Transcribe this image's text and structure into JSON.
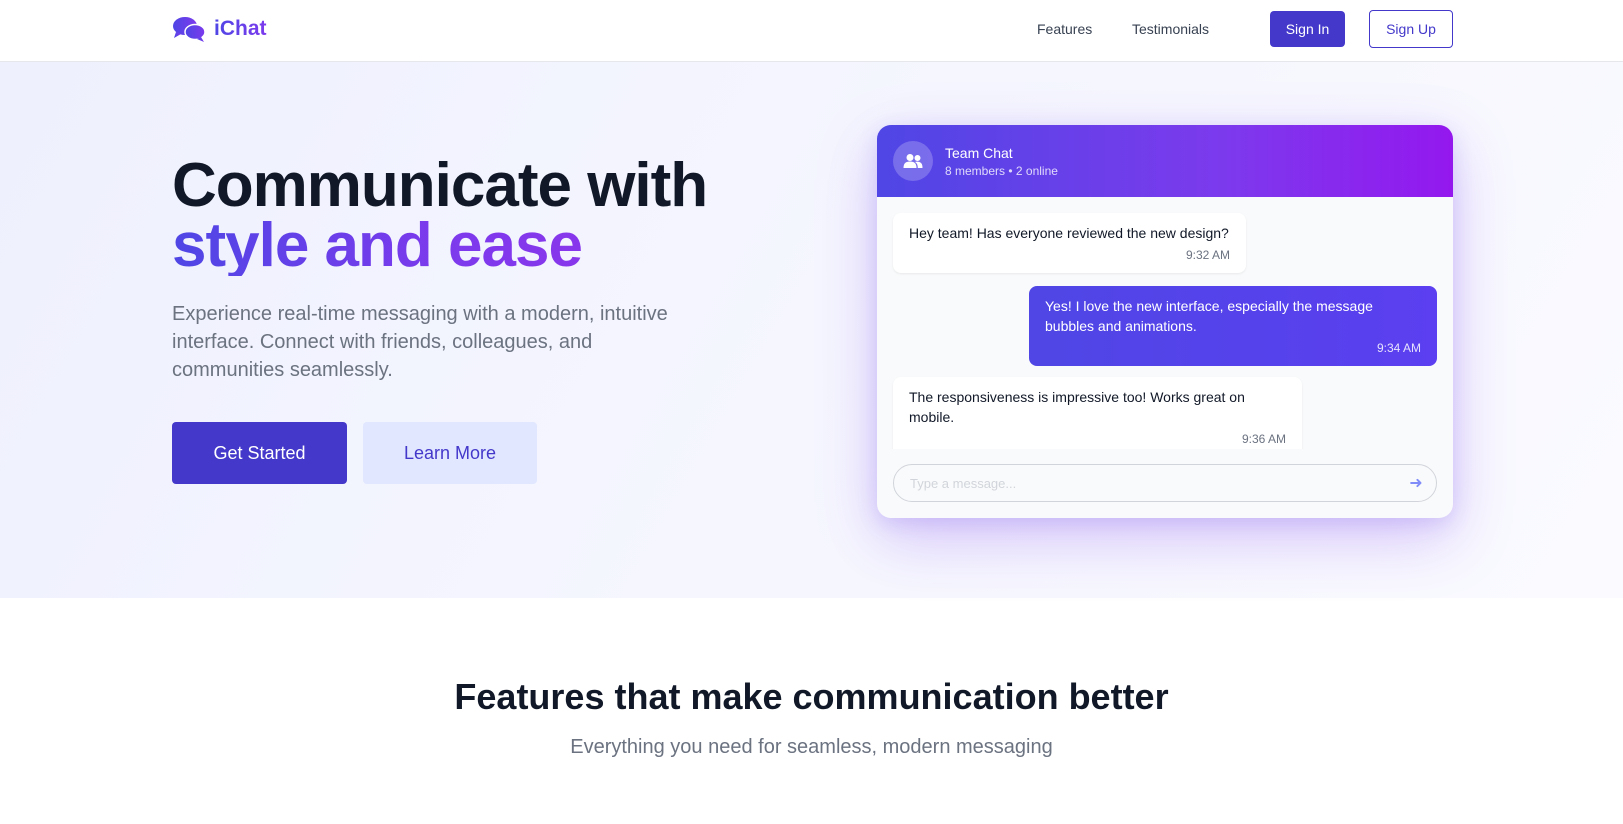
{
  "nav": {
    "brand": "iChat",
    "links": [
      "Features",
      "Testimonials"
    ],
    "sign_in": "Sign In",
    "sign_up": "Sign Up"
  },
  "hero": {
    "title_line1": "Communicate with",
    "title_line2": "style and ease",
    "subtitle": "Experience real-time messaging with a modern, intuitive interface. Connect with friends, colleagues, and communities seamlessly.",
    "primary_button": "Get Started",
    "secondary_button": "Learn More"
  },
  "chat": {
    "title": "Team Chat",
    "meta": "8 members • 2 online",
    "messages": [
      {
        "direction": "incoming",
        "text": "Hey team! Has everyone reviewed the new design?",
        "time": "9:32 AM"
      },
      {
        "direction": "outgoing",
        "text": "Yes! I love the new interface, especially the message bubbles and animations.",
        "time": "9:34 AM"
      },
      {
        "direction": "incoming",
        "text": "The responsiveness is impressive too! Works great on mobile.",
        "time": "9:36 AM"
      }
    ],
    "input_placeholder": "Type a message...",
    "input_value": "",
    "send_icon": "arrow-right-icon",
    "avatar_icon": "users-icon"
  },
  "features": {
    "title": "Features that make communication better",
    "subtitle": "Everything you need for seamless, modern messaging"
  },
  "colors": {
    "primary": "#4338ca",
    "accent": "#7c3aed",
    "light_button": "#e0e7ff",
    "text_dark": "#111827",
    "text_muted": "#6b7280"
  }
}
